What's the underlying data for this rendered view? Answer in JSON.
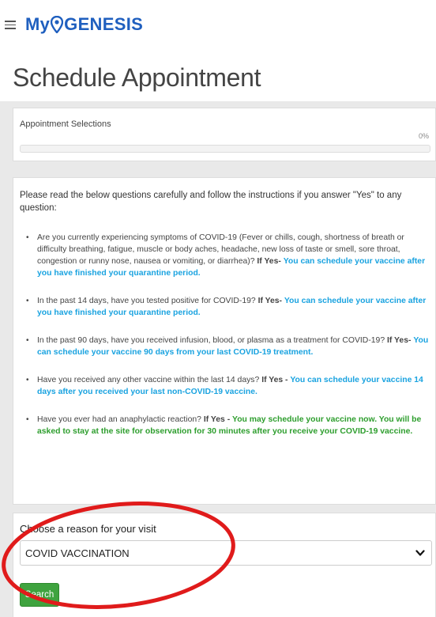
{
  "header": {
    "brand_prefix": "My",
    "brand_suffix": "GENESIS",
    "brand_color": "#1f5fbf"
  },
  "page": {
    "title": "Schedule Appointment"
  },
  "selections": {
    "label": "Appointment Selections",
    "progress_text": "0%",
    "progress_value": 0
  },
  "questions": {
    "intro": "Please read the below questions carefully and follow the instructions if you answer \"Yes\" to any question:",
    "items": [
      {
        "text": "Are you currently experiencing symptoms of COVID-19 (Fever or chills, cough, shortness of breath or difficulty breathing, fatigue, muscle or body aches, headache, new loss of taste or smell, sore throat, congestion or runny nose, nausea or vomiting, or diarrhea)?",
        "if_yes": "If Yes-",
        "advice": "You can schedule your vaccine after you have finished your quarantine period."
      },
      {
        "text": "In the past 14 days, have you tested positive for COVID-19?",
        "if_yes": "If Yes-",
        "advice": "You can schedule your vaccine after you have finished your quarantine period."
      },
      {
        "text": "In the past 90 days, have you received infusion, blood, or plasma as a treatment for COVID-19?",
        "if_yes": "If Yes-",
        "advice": "You can schedule your vaccine 90 days from your last COVID-19 treatment."
      },
      {
        "text": "Have you received any other vaccine within the last 14 days?",
        "if_yes": "If Yes -",
        "advice": "You can schedule your vaccine 14 days after you received your last non-COVID-19 vaccine."
      },
      {
        "text": "Have you ever had an anaphylactic reaction?",
        "if_yes": "If Yes -",
        "advice": "You may schedule your vaccine now. You will be asked to stay at the site for observation for 30 minutes after you receive your COVID-19 vaccine."
      }
    ]
  },
  "reason": {
    "label": "Choose a reason for your visit",
    "selected": "COVID VACCINATION",
    "search_label": "Search"
  },
  "icons": {
    "menu": "hamburger-menu-icon",
    "pin": "location-pin-icon",
    "select": "chevron-down-icon"
  },
  "colors": {
    "advice_blue": "#1aa3e0",
    "advice_green": "#2e9e2e",
    "search_button": "#3fa33f",
    "annotation": "#e01b1b"
  }
}
